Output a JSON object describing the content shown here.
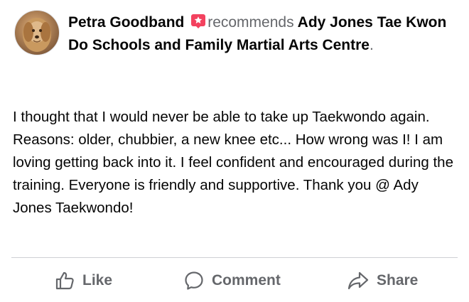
{
  "post": {
    "author": "Petra Goodband",
    "verb": "recommends",
    "page_name": "Ady Jones Tae Kwon Do Schools and Family Martial Arts Centre",
    "period": ".",
    "body": "I thought that I would never be able to take up Taekwondo again. Reasons: older, chubbier, a new knee etc... How wrong was I! I am loving getting back into it. I feel confident and encouraged during the training. Everyone is friendly and supportive. Thank you @ Ady Jones Taekwondo!"
  },
  "actions": {
    "like_label": "Like",
    "comment_label": "Comment",
    "share_label": "Share"
  },
  "icons": {
    "recommend_badge": "recommend-star-icon",
    "like": "thumbs-up-icon",
    "comment": "comment-bubble-icon",
    "share": "share-arrow-icon"
  },
  "colors": {
    "text": "#050505",
    "muted": "#65676b",
    "badge": "#f3425f",
    "divider": "#ced0d4"
  }
}
